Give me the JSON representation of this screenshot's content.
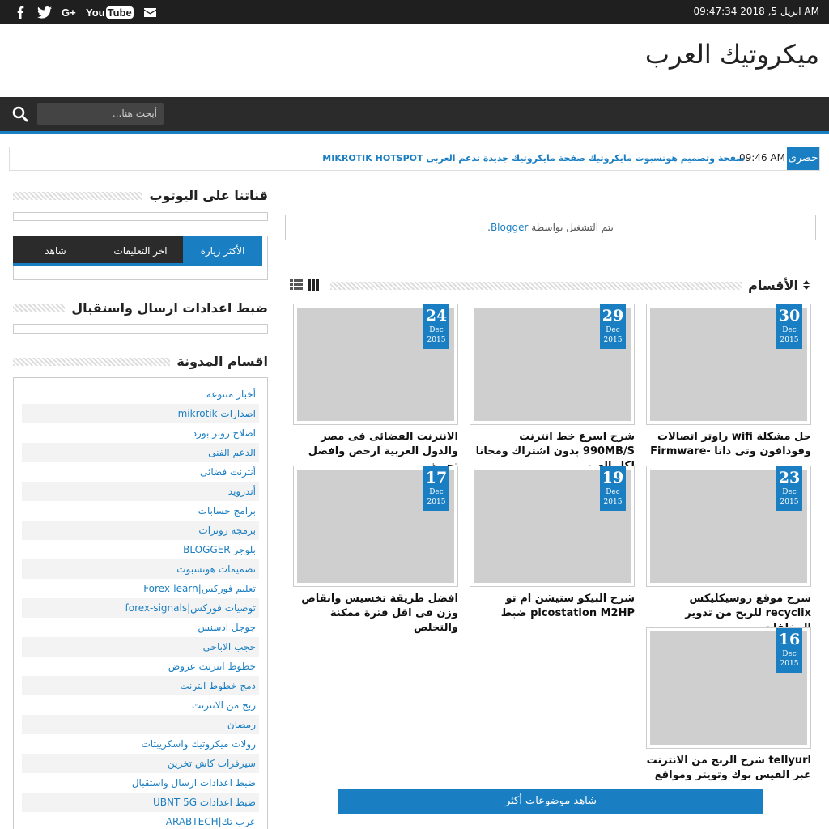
{
  "topbar": {
    "datetime": "ابريل 5, 2018 09:47:34 AM",
    "social": [
      "facebook-icon",
      "twitter-icon",
      "google-plus-icon",
      "youtube-icon",
      "mail-icon"
    ],
    "youtube_label_you": "You",
    "youtube_label_tube": "Tube"
  },
  "header": {
    "site_title": "ميكروتيك العرب"
  },
  "search": {
    "placeholder": "أبحث هنا..."
  },
  "ticker": {
    "label": "حصرى",
    "time": "09:46 AM",
    "headline": "صفحة وتصميم هوتسبوت مايكروتيك صفحة مايكروتيك جديدة تدعم العربى MIKROTIK HOTSPOT"
  },
  "sidebar": {
    "youtube_heading": "قناتنا على اليوتوب",
    "tabs": [
      "الأكثر زيارة",
      "اخر التعليقات",
      "شاهد"
    ],
    "settings_heading": "ضبط اعدادات ارسال واستقبال",
    "categories_heading": "اقسام المدونة",
    "categories": [
      "أخبار متنوعة",
      "اصدارات mikrotik",
      "اصلاح روتر بورد",
      "الدعم الفنى",
      "أنترنت فضائى",
      "أندرويد",
      "برامج حسابات",
      "برمجة روترات",
      "بلوجر BLOGGER",
      "تصميمات هوتسبوت",
      "تعليم فوركس|Forex-learn",
      "توصيات فوركس|forex-signals",
      "جوجل ادسنس",
      "حجب الاباحى",
      "خطوط انترنت عروض",
      "دمج خطوط انترنت",
      "ربح من الانترنت",
      "رمضان",
      "رولات ميكروتيك واسكريبتات",
      "سيرفرات كاش تخزين",
      "ضبط اعدادات ارسال واستقبال",
      "ضبط اعدادات UBNT 5G",
      "عرب تك|ARABTECH"
    ]
  },
  "main": {
    "powered_prefix": "يتم التشغيل بواسطة",
    "powered_link": "Blogger",
    "powered_suffix": ".",
    "sections_heading": "الأقسام",
    "posts": [
      {
        "day": "30",
        "month": "Dec",
        "year": "2015",
        "title": "حل مشكلة wifi راوتر اتصالات وفودافون وتى داتا -Firmware"
      },
      {
        "day": "29",
        "month": "Dec",
        "year": "2015",
        "title": "شرح اسرع خط انترنت 990MB/S بدون اشتراك ومجانا لكل العرب"
      },
      {
        "day": "24",
        "month": "Dec",
        "year": "2015",
        "title": "الانترنت الفضائى فى مصر والدول العربية ارخص وافضل تجربة"
      },
      {
        "day": "23",
        "month": "Dec",
        "year": "2015",
        "title": "شرح موقع روسيكليكس recyclix للربح من تدوير المخلفات"
      },
      {
        "day": "19",
        "month": "Dec",
        "year": "2015",
        "title": "شرح البيكو ستيشن ام تو picostation M2HP ضبط"
      },
      {
        "day": "17",
        "month": "Dec",
        "year": "2015",
        "title": "افضل طريقة تخسيس وانقاص وزن فى اقل فترة ممكنة والتخلص"
      },
      {
        "day": "16",
        "month": "Dec",
        "year": "2015",
        "title": "tellyurl شرح الربح من الانترنت عبر الفيس بوك وتويتر ومواقع"
      }
    ],
    "more_button": "شاهد موضوعات أكثر"
  }
}
